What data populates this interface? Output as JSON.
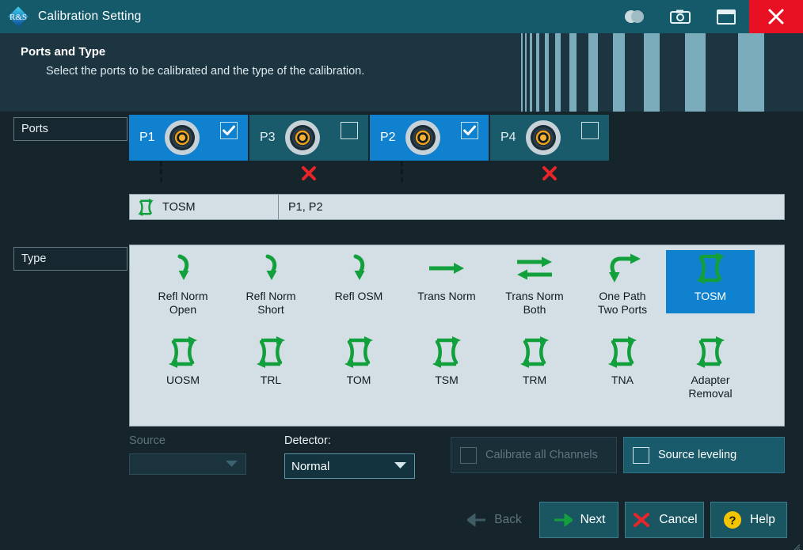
{
  "window": {
    "title": "Calibration Setting",
    "logo_icon": "rohde-schwarz-logo-icon",
    "buttons": [
      {
        "name": "contrast-toggle-icon",
        "label": ""
      },
      {
        "name": "camera-icon",
        "label": ""
      },
      {
        "name": "window-restore-icon",
        "label": ""
      },
      {
        "name": "close-icon",
        "label": ""
      }
    ],
    "close_color": "#e81123",
    "titlebar_color": "#155a6b"
  },
  "header": {
    "title": "Ports and Type",
    "subtitle": "Select the ports to be calibrated and the type of the calibration.",
    "stripe_color": "#7aacbb",
    "background": "#1d3540"
  },
  "ports_section": {
    "label": "Ports",
    "selected_color": "#1081ce",
    "unselected_color": "#1a5b6b",
    "ports": [
      {
        "name": "P1",
        "checked": true,
        "connected": true
      },
      {
        "name": "P3",
        "checked": false,
        "connected": false
      },
      {
        "name": "P2",
        "checked": true,
        "connected": true
      },
      {
        "name": "P4",
        "checked": false,
        "connected": false
      }
    ]
  },
  "summary": {
    "icon": "tosm-2port-icon",
    "type_name": "TOSM",
    "ports_text": "P1, P2"
  },
  "type_section": {
    "label": "Type",
    "selected": "TOSM",
    "items": [
      {
        "label": "Refl Norm Open",
        "icon": "refl-arrow-icon",
        "selected": false
      },
      {
        "label": "Refl Norm Short",
        "icon": "refl-arrow-icon",
        "selected": false
      },
      {
        "label": "Refl OSM",
        "icon": "refl-arrow-icon",
        "selected": false
      },
      {
        "label": "Trans Norm",
        "icon": "trans-arrow-icon",
        "selected": false
      },
      {
        "label": "Trans Norm Both",
        "icon": "trans-both-icon",
        "selected": false
      },
      {
        "label": "One Path Two Ports",
        "icon": "one-path-icon",
        "selected": false
      },
      {
        "label": "TOSM",
        "icon": "tosm-2port-icon",
        "selected": true
      },
      {
        "label": "UOSM",
        "icon": "tosm-2port-icon",
        "selected": false
      },
      {
        "label": "TRL",
        "icon": "tosm-2port-icon",
        "selected": false
      },
      {
        "label": "TOM",
        "icon": "tosm-2port-icon",
        "selected": false
      },
      {
        "label": "TSM",
        "icon": "tosm-2port-icon",
        "selected": false
      },
      {
        "label": "TRM",
        "icon": "tosm-2port-icon",
        "selected": false
      },
      {
        "label": "TNA",
        "icon": "tosm-2port-icon",
        "selected": false
      },
      {
        "label": "Adapter Removal",
        "icon": "tosm-2port-icon",
        "selected": false
      }
    ]
  },
  "controls": {
    "source": {
      "label": "Source",
      "value": "",
      "enabled": false
    },
    "detector": {
      "label": "Detector:",
      "value": "Normal",
      "enabled": true
    },
    "calibrate_all": {
      "label": "Calibrate all Channels",
      "checked": false,
      "enabled": false
    },
    "source_leveling": {
      "label": "Source leveling",
      "checked": false,
      "enabled": true
    }
  },
  "footer": {
    "buttons": [
      {
        "label": "Back",
        "icon": "arrow-left-icon",
        "enabled": false
      },
      {
        "label": "Next",
        "icon": "arrow-right-icon",
        "enabled": true
      },
      {
        "label": "Cancel",
        "icon": "x-icon",
        "enabled": true
      },
      {
        "label": "Help",
        "icon": "question-icon",
        "enabled": true
      }
    ]
  },
  "colors": {
    "accent_green": "#12a03c",
    "accent_blue": "#1081ce",
    "panel_light": "#d3dfe4",
    "red": "#e8252a",
    "yellow": "#f5c400"
  }
}
